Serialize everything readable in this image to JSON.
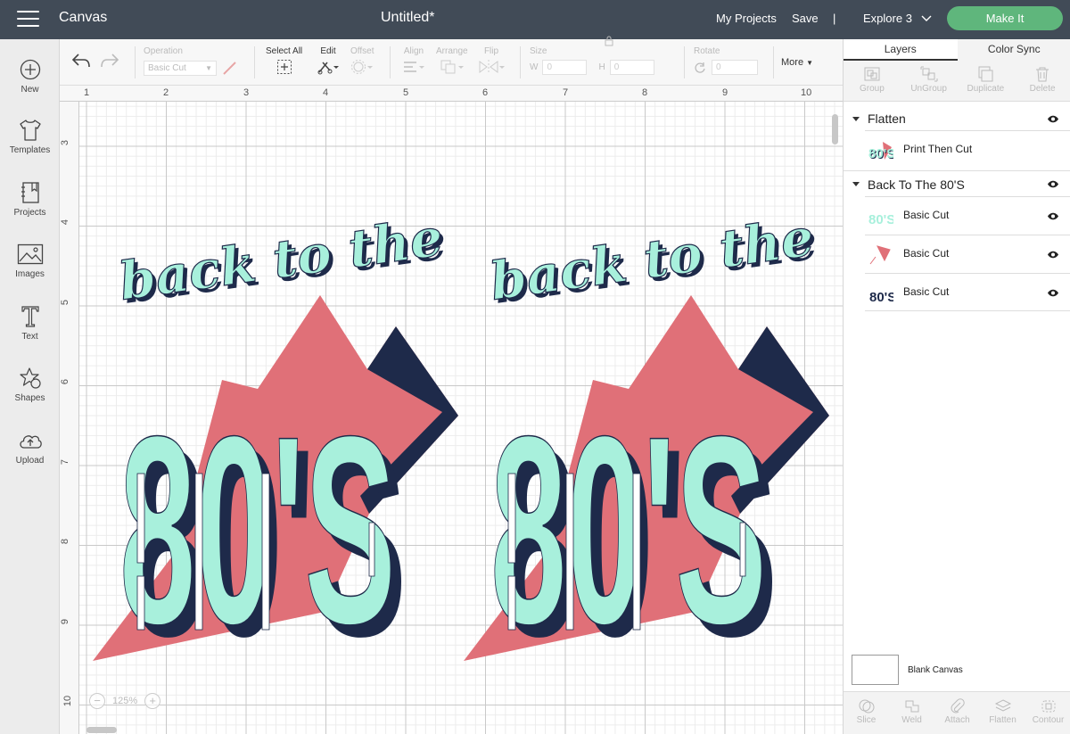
{
  "topbar": {
    "app_title": "Canvas",
    "doc_title": "Untitled*",
    "my_projects": "My Projects",
    "save": "Save",
    "divider": "|",
    "machine": "Explore 3",
    "make_it": "Make It"
  },
  "leftbar": {
    "items": [
      {
        "label": "New",
        "icon": "plus-circle-icon"
      },
      {
        "label": "Templates",
        "icon": "tshirt-icon"
      },
      {
        "label": "Projects",
        "icon": "notebook-icon"
      },
      {
        "label": "Images",
        "icon": "image-icon"
      },
      {
        "label": "Text",
        "icon": "text-t-icon"
      },
      {
        "label": "Shapes",
        "icon": "shapes-icon"
      },
      {
        "label": "Upload",
        "icon": "cloud-upload-icon"
      }
    ]
  },
  "toolbar": {
    "operation_label": "Operation",
    "operation_value": "Basic Cut",
    "select_all": "Select All",
    "edit": "Edit",
    "offset": "Offset",
    "align": "Align",
    "arrange": "Arrange",
    "flip": "Flip",
    "size": "Size",
    "w_label": "W",
    "h_label": "H",
    "w_value": "0",
    "h_value": "0",
    "rotate": "Rotate",
    "rotate_value": "0",
    "more": "More"
  },
  "canvas": {
    "ruler_top": [
      "1",
      "2",
      "3",
      "4",
      "5",
      "6",
      "7",
      "8",
      "9",
      "10"
    ],
    "ruler_left": [
      "3",
      "4",
      "5",
      "6",
      "7",
      "8",
      "9",
      "10"
    ],
    "zoom": "125%",
    "zoom_minus": "−",
    "zoom_plus": "+",
    "artwork": {
      "line1": "back to the",
      "line2": "80'S",
      "colors": {
        "mint": "#a8f0dc",
        "navy": "#1e2a4a",
        "coral": "#e07078"
      }
    }
  },
  "rightpanel": {
    "tabs": [
      "Layers",
      "Color Sync"
    ],
    "actions": [
      "Group",
      "UnGroup",
      "Duplicate",
      "Delete"
    ],
    "groups": [
      {
        "title": "Flatten",
        "layers": [
          {
            "name": "Print Then Cut"
          }
        ]
      },
      {
        "title": "Back To The 80'S",
        "layers": [
          {
            "name": "Basic Cut"
          },
          {
            "name": "Basic Cut"
          },
          {
            "name": "Basic Cut"
          }
        ]
      }
    ],
    "blank_canvas": "Blank Canvas",
    "bottom_actions": [
      "Slice",
      "Weld",
      "Attach",
      "Flatten",
      "Contour"
    ]
  }
}
